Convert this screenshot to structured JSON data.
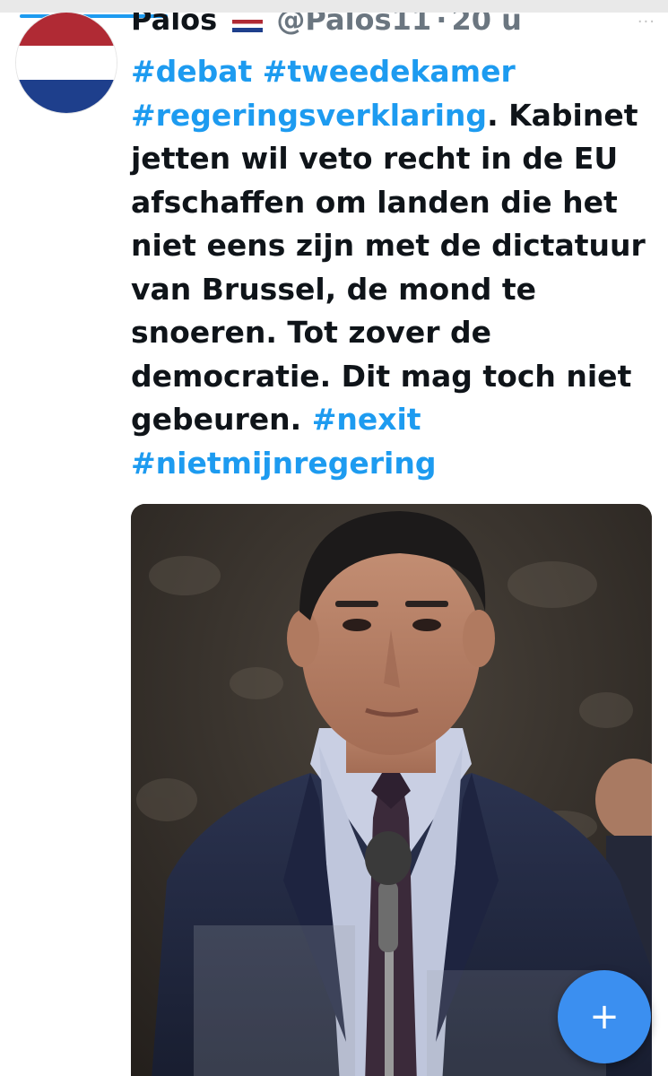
{
  "tweet": {
    "display_name": "Palos",
    "handle": "@Palos11",
    "separator": "·",
    "time": "20 u",
    "text_lines": [
      [
        {
          "t": "#debat #tweedekamer",
          "tag": true
        }
      ],
      [
        {
          "t": "#regeringsverklaring",
          "tag": true
        },
        {
          "t": ". Kabinet",
          "tag": false
        }
      ],
      [
        {
          "t": "jetten wil veto recht in de EU",
          "tag": false
        }
      ],
      [
        {
          "t": "afschaffen om landen die het",
          "tag": false
        }
      ],
      [
        {
          "t": "niet eens zijn met de dictatuur",
          "tag": false
        }
      ],
      [
        {
          "t": "van Brussel, de mond te",
          "tag": false
        }
      ],
      [
        {
          "t": "snoeren.  Tot zover de",
          "tag": false
        }
      ],
      [
        {
          "t": "democratie.  Dit mag toch niet",
          "tag": false
        }
      ],
      [
        {
          "t": "gebeuren.  ",
          "tag": false
        },
        {
          "t": "#nexit",
          "tag": true
        }
      ],
      [
        {
          "t": "#nietmijnregering",
          "tag": true
        }
      ]
    ]
  },
  "icons": {
    "avatar": "netherlands-flag-avatar",
    "name_flag": "netherlands-flag-emoji",
    "more": "more-options-icon",
    "compose": "plus-icon"
  },
  "compose_button": {
    "label": "+"
  },
  "more_options": {
    "label": "···"
  },
  "colors": {
    "hashtag": "#1d9bf0",
    "text": "#0f1419",
    "muted": "#6b7680",
    "fab": "#3b8ff0"
  }
}
